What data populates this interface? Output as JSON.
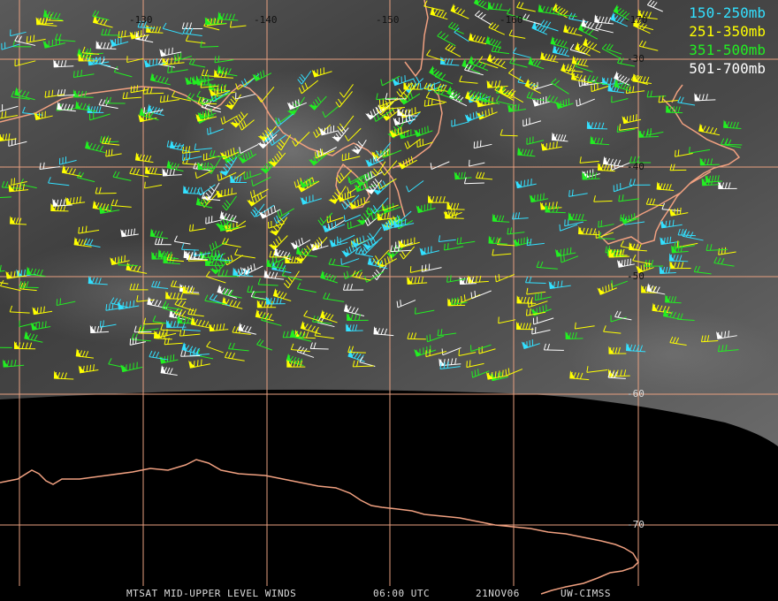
{
  "longitude_labels": [
    "-130",
    "-140",
    "-150",
    "-160",
    "-170"
  ],
  "latitude_labels": [
    "-30",
    "-40",
    "-50",
    "-60",
    "-70"
  ],
  "legend": [
    {
      "label": "150-250mb",
      "color": "#33e0ff"
    },
    {
      "label": "251-350mb",
      "color": "#ffff00"
    },
    {
      "label": "351-500mb",
      "color": "#22ee22"
    },
    {
      "label": "501-700mb",
      "color": "#ffffff"
    }
  ],
  "footer": {
    "product": "MTSAT MID-UPPER LEVEL WINDS",
    "time": "06:00 UTC",
    "date": "21NOV06",
    "source": "UW-CIMSS"
  },
  "colors": {
    "coastline": "#f0a080",
    "grid": "#e8a080"
  }
}
